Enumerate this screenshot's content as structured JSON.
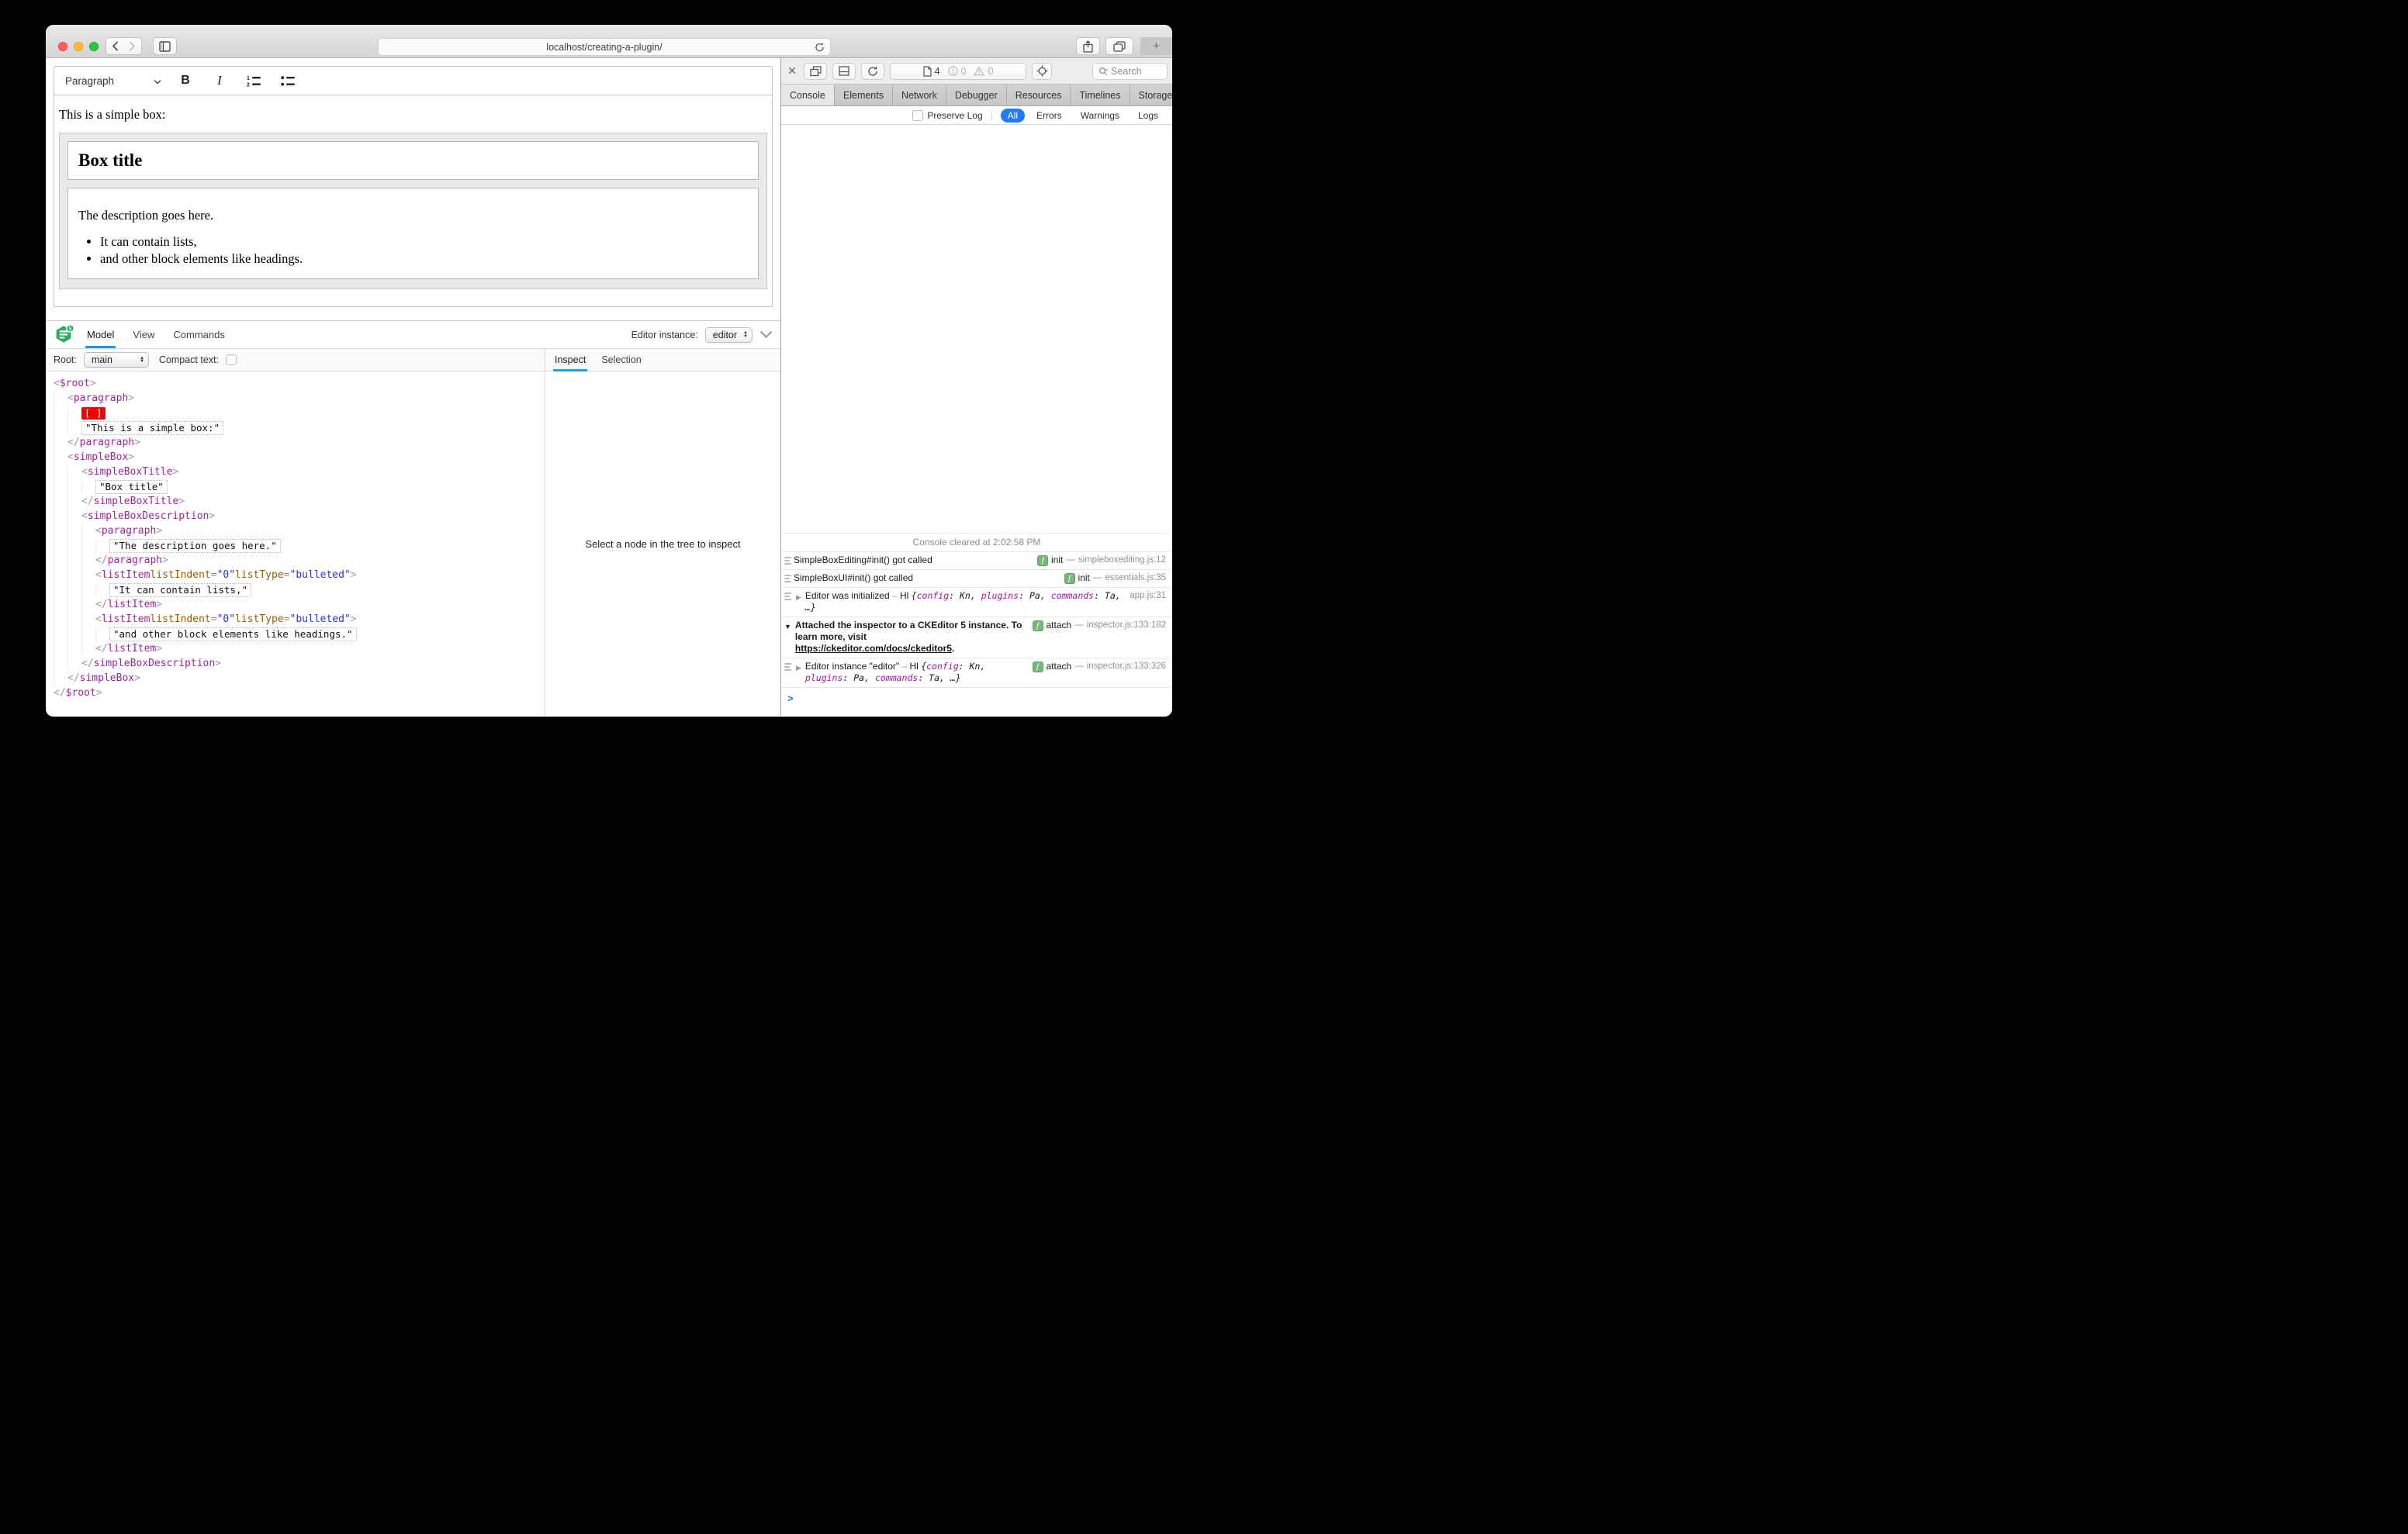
{
  "browser": {
    "url": "localhost/creating-a-plugin/",
    "newtab_label": "+",
    "traffic_lights": [
      "close",
      "minimize",
      "zoom"
    ]
  },
  "editor": {
    "toolbar": {
      "paragraph_dropdown": "Paragraph",
      "bold_label": "B",
      "italic_label": "I"
    },
    "content": {
      "intro": "This is a simple box:",
      "box_title": "Box title",
      "description": "The description goes here.",
      "list_items": [
        "It can contain lists,",
        "and other block elements like headings."
      ]
    }
  },
  "inspector": {
    "tabs": [
      {
        "label": "Model",
        "active": true
      },
      {
        "label": "View"
      },
      {
        "label": "Commands"
      }
    ],
    "editor_instance_label": "Editor instance:",
    "editor_instance_value": "editor",
    "root_label": "Root:",
    "root_value": "main",
    "compact_text_label": "Compact text:",
    "side_tabs": [
      {
        "label": "Inspect",
        "active": true
      },
      {
        "label": "Selection"
      }
    ],
    "empty_message": "Select a node in the tree to inspect",
    "tree": [
      {
        "k": "open",
        "n": "$root",
        "i": 0
      },
      {
        "k": "open",
        "n": "paragraph",
        "i": 1
      },
      {
        "k": "marker",
        "i": 2
      },
      {
        "k": "text",
        "t": "This is a simple box:",
        "i": 2
      },
      {
        "k": "close",
        "n": "paragraph",
        "i": 1
      },
      {
        "k": "open",
        "n": "simpleBox",
        "i": 1
      },
      {
        "k": "open",
        "n": "simpleBoxTitle",
        "i": 2
      },
      {
        "k": "text",
        "t": "Box title",
        "i": 3
      },
      {
        "k": "close",
        "n": "simpleBoxTitle",
        "i": 2
      },
      {
        "k": "open",
        "n": "simpleBoxDescription",
        "i": 2
      },
      {
        "k": "open",
        "n": "paragraph",
        "i": 3
      },
      {
        "k": "text",
        "t": "The description goes here.",
        "i": 4
      },
      {
        "k": "close",
        "n": "paragraph",
        "i": 3
      },
      {
        "k": "open",
        "n": "listItem",
        "a": [
          [
            "listIndent",
            "0"
          ],
          [
            "listType",
            "bulleted"
          ]
        ],
        "i": 3
      },
      {
        "k": "text",
        "t": "It can contain lists,",
        "i": 4
      },
      {
        "k": "close",
        "n": "listItem",
        "i": 3
      },
      {
        "k": "open",
        "n": "listItem",
        "a": [
          [
            "listIndent",
            "0"
          ],
          [
            "listType",
            "bulleted"
          ]
        ],
        "i": 3
      },
      {
        "k": "text",
        "t": "and other block elements like headings.",
        "i": 4
      },
      {
        "k": "close",
        "n": "listItem",
        "i": 3
      },
      {
        "k": "close",
        "n": "simpleBoxDescription",
        "i": 2
      },
      {
        "k": "close",
        "n": "simpleBox",
        "i": 1
      },
      {
        "k": "close",
        "n": "$root",
        "i": 0
      }
    ]
  },
  "devtools": {
    "toolbar": {
      "page_count": "4",
      "error_count": "0",
      "warning_count": "0",
      "search_placeholder": "Search"
    },
    "tabs": [
      {
        "label": "Console",
        "active": true
      },
      {
        "label": "Elements"
      },
      {
        "label": "Network"
      },
      {
        "label": "Debugger"
      },
      {
        "label": "Resources"
      },
      {
        "label": "Timelines"
      },
      {
        "label": "Storage"
      }
    ],
    "tab_overflow": "»",
    "tab_add": "+",
    "filter": {
      "preserve_log_label": "Preserve Log",
      "scopes": [
        {
          "label": "All",
          "active": true
        },
        {
          "label": "Errors"
        },
        {
          "label": "Warnings"
        },
        {
          "label": "Logs"
        }
      ]
    },
    "console": {
      "cleared_message": "Console cleared at 2:02:58 PM",
      "prompt_char": ">",
      "messages": [
        {
          "icon": true,
          "disclosure": null,
          "bold": false,
          "parts": [
            {
              "t": "SimpleBoxEditing#init() got called",
              "s": "p"
            }
          ],
          "fn": "init",
          "source": "simpleboxediting.js:12"
        },
        {
          "icon": true,
          "disclosure": null,
          "bold": false,
          "parts": [
            {
              "t": "SimpleBoxUI#init() got called",
              "s": "p"
            }
          ],
          "fn": "init",
          "source": "essentials.js:35"
        },
        {
          "icon": true,
          "disclosure": "closed",
          "bold": false,
          "parts": [
            {
              "t": "Editor was initialized",
              "s": "p"
            },
            {
              "t": " – ",
              "s": "d"
            },
            {
              "t": "Hl ",
              "s": "p"
            },
            {
              "t": "{",
              "s": "o"
            },
            {
              "t": "config",
              "s": "pr"
            },
            {
              "t": ": Kn, ",
              "s": "o"
            },
            {
              "t": "plugins",
              "s": "pr"
            },
            {
              "t": ": Pa, ",
              "s": "o"
            },
            {
              "t": "commands",
              "s": "pr"
            },
            {
              "t": ": Ta, …}",
              "s": "o"
            }
          ],
          "fn": null,
          "source": "app.js:31"
        },
        {
          "icon": false,
          "disclosure": "open",
          "bold": true,
          "parts": [
            {
              "t": "Attached the inspector to a CKEditor 5 instance. To learn more, visit ",
              "s": "p"
            },
            {
              "t": "https://ckeditor.com/docs/ckeditor5",
              "s": "ln"
            },
            {
              "t": ".",
              "s": "p"
            }
          ],
          "fn": "attach",
          "source": "inspector.js:133:182"
        },
        {
          "icon": true,
          "disclosure": "closed",
          "bold": false,
          "parts": [
            {
              "t": "Editor instance \"editor\"",
              "s": "p"
            },
            {
              "t": " – ",
              "s": "d"
            },
            {
              "t": "Hl ",
              "s": "p"
            },
            {
              "t": "{",
              "s": "o"
            },
            {
              "t": "config",
              "s": "pr"
            },
            {
              "t": ": Kn, ",
              "s": "o"
            },
            {
              "t": "plugins",
              "s": "pr"
            },
            {
              "t": ": Pa, ",
              "s": "o"
            },
            {
              "t": "commands",
              "s": "pr"
            },
            {
              "t": ": Ta, …}",
              "s": "o"
            }
          ],
          "fn": "attach",
          "source": "inspector.js:133:326"
        }
      ]
    }
  },
  "colors": {
    "accent_blue_underline": "#1b9af2",
    "filter_active_blue": "#217bf4",
    "marker_red": "#f50000",
    "tag_purple": "#a0239f",
    "attr_name_orange": "#9b5c00",
    "attr_value_blue": "#2433d6",
    "badge_green": "#79b679",
    "logo_green": "#28ab5f",
    "prompt_blue": "#1673ff"
  }
}
